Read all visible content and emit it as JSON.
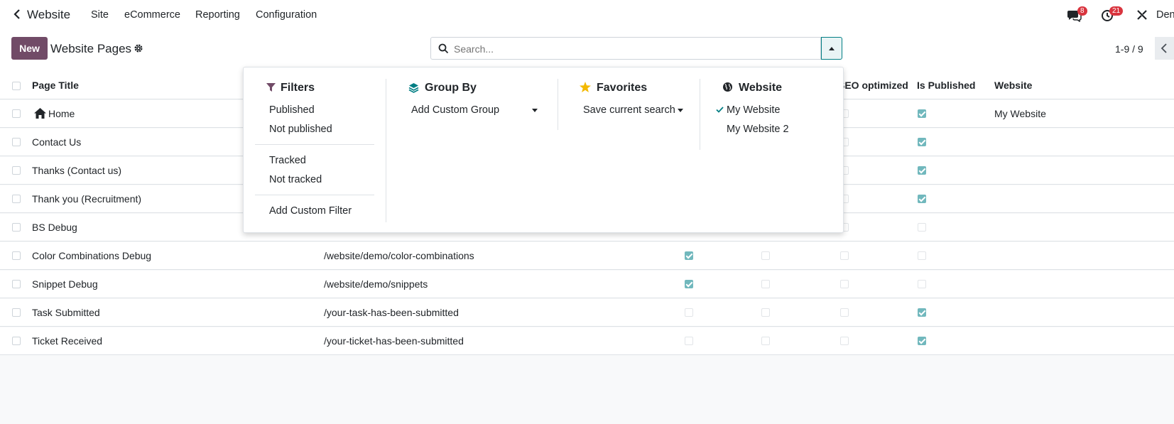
{
  "nav": {
    "app_title": "Website",
    "menu": [
      "Site",
      "eCommerce",
      "Reporting",
      "Configuration"
    ],
    "messages_count": "8",
    "activities_count": "21",
    "user_label": "Den"
  },
  "control": {
    "new_label": "New",
    "page_title": "Website Pages",
    "search_placeholder": "Search...",
    "pager": "1-9 / 9"
  },
  "table": {
    "headers": {
      "page_title": "Page Title",
      "seo_optimized": "SEO optimized",
      "is_published": "Is Published",
      "website": "Website"
    },
    "rows": [
      {
        "title": "Home",
        "url": "",
        "c1": false,
        "c2": false,
        "seo": false,
        "published": true,
        "website": "My Website"
      },
      {
        "title": "Contact Us",
        "url": "",
        "c1": false,
        "c2": false,
        "seo": false,
        "published": true,
        "website": ""
      },
      {
        "title": "Thanks (Contact us)",
        "url": "",
        "c1": false,
        "c2": false,
        "seo": false,
        "published": true,
        "website": ""
      },
      {
        "title": "Thank you (Recruitment)",
        "url": "",
        "c1": false,
        "c2": false,
        "seo": false,
        "published": true,
        "website": ""
      },
      {
        "title": "BS Debug",
        "url": "",
        "c1": true,
        "c2": false,
        "seo": false,
        "published": false,
        "website": ""
      },
      {
        "title": "Color Combinations Debug",
        "url": "/website/demo/color-combinations",
        "c1": true,
        "c2": false,
        "seo": false,
        "published": false,
        "website": ""
      },
      {
        "title": "Snippet Debug",
        "url": "/website/demo/snippets",
        "c1": true,
        "c2": false,
        "seo": false,
        "published": false,
        "website": ""
      },
      {
        "title": "Task Submitted",
        "url": "/your-task-has-been-submitted",
        "c1": false,
        "c2": false,
        "seo": false,
        "published": true,
        "website": ""
      },
      {
        "title": "Ticket Received",
        "url": "/your-ticket-has-been-submitted",
        "c1": false,
        "c2": false,
        "seo": false,
        "published": true,
        "website": ""
      }
    ]
  },
  "dropdown": {
    "filters": {
      "title": "Filters",
      "published": "Published",
      "not_published": "Not published",
      "tracked": "Tracked",
      "not_tracked": "Not tracked",
      "add_custom": "Add Custom Filter"
    },
    "group_by": {
      "title": "Group By",
      "add_custom": "Add Custom Group"
    },
    "favorites": {
      "title": "Favorites",
      "save_current": "Save current search"
    },
    "website": {
      "title": "Website",
      "options": [
        "My Website",
        "My Website 2"
      ]
    }
  },
  "colors": {
    "brand": "#714b67",
    "accent": "#017e84",
    "check": "#71b8bd",
    "badge": "#d9343e"
  }
}
